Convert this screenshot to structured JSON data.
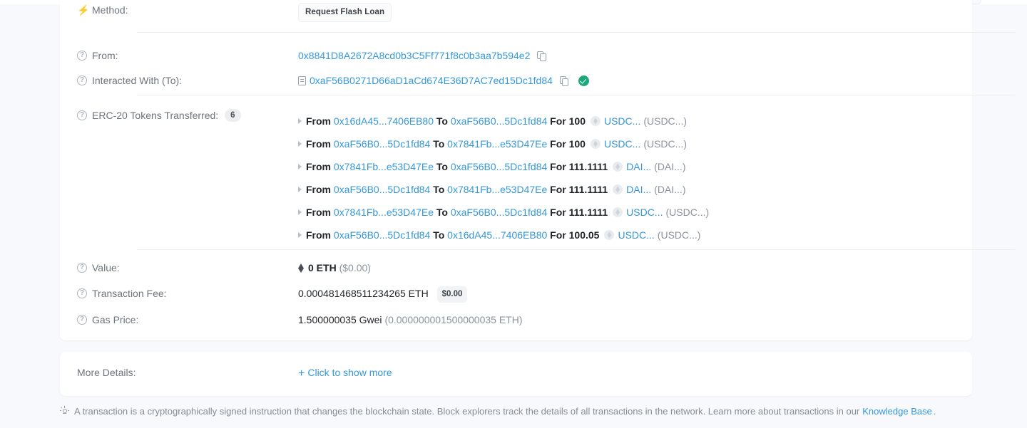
{
  "page": {
    "background_color": "#f8f9fc",
    "link_color": "#3498db",
    "accent_green": "#1aa87c"
  },
  "details": {
    "method": {
      "label": "Method:",
      "icon": "lightning-bolt-icon",
      "badge": "Request Flash Loan"
    },
    "from": {
      "label": "From:",
      "address": "0x8841D8A2672A8cd0b3C5Ff771f8c0b3aa7b594e2"
    },
    "interacted_with": {
      "label": "Interacted With (To):",
      "address": "0xaF56B0271D66aD1aCd674E36D7AC7ed15Dc1fd84",
      "verified": true
    },
    "erc20": {
      "label": "ERC-20 Tokens Transferred:",
      "count": "6",
      "from_word": "From",
      "to_word": "To",
      "for_word": "For",
      "transfers": [
        {
          "from": "0x16dA45...7406EB80",
          "to": "0xaF56B0...5Dc1fd84",
          "amount": "100",
          "symbol": "USDC...",
          "full_name": "(USDC...)"
        },
        {
          "from": "0xaF56B0...5Dc1fd84",
          "to": "0x7841Fb...e53D47Ee",
          "amount": "100",
          "symbol": "USDC...",
          "full_name": "(USDC...)"
        },
        {
          "from": "0x7841Fb...e53D47Ee",
          "to": "0xaF56B0...5Dc1fd84",
          "amount": "111.1111",
          "symbol": "DAI...",
          "full_name": "(DAI...)"
        },
        {
          "from": "0xaF56B0...5Dc1fd84",
          "to": "0x7841Fb...e53D47Ee",
          "amount": "111.1111",
          "symbol": "DAI...",
          "full_name": "(DAI...)"
        },
        {
          "from": "0x7841Fb...e53D47Ee",
          "to": "0xaF56B0...5Dc1fd84",
          "amount": "111.1111",
          "symbol": "USDC...",
          "full_name": "(USDC...)"
        },
        {
          "from": "0xaF56B0...5Dc1fd84",
          "to": "0x16dA45...7406EB80",
          "amount": "100.05",
          "symbol": "USDC...",
          "full_name": "(USDC...)"
        }
      ]
    },
    "value": {
      "label": "Value:",
      "amount": "0 ETH",
      "usd": "($0.00)"
    },
    "transaction_fee": {
      "label": "Transaction Fee:",
      "amount": "0.000481468511234265 ETH",
      "usd_badge": "$0.00"
    },
    "gas_price": {
      "label": "Gas Price:",
      "gwei": "1.500000035 Gwei",
      "eth": "(0.000000001500000035 ETH)"
    }
  },
  "more_details": {
    "label": "More Details:",
    "toggle_plus": "+",
    "toggle_text": "Click to show more"
  },
  "footer": {
    "icon": "lightbulb-icon",
    "text": "A transaction is a cryptographically signed instruction that changes the blockchain state. Block explorers track the details of all transactions in the network. Learn more about transactions in our",
    "link_text": "Knowledge Base",
    "period": "."
  }
}
